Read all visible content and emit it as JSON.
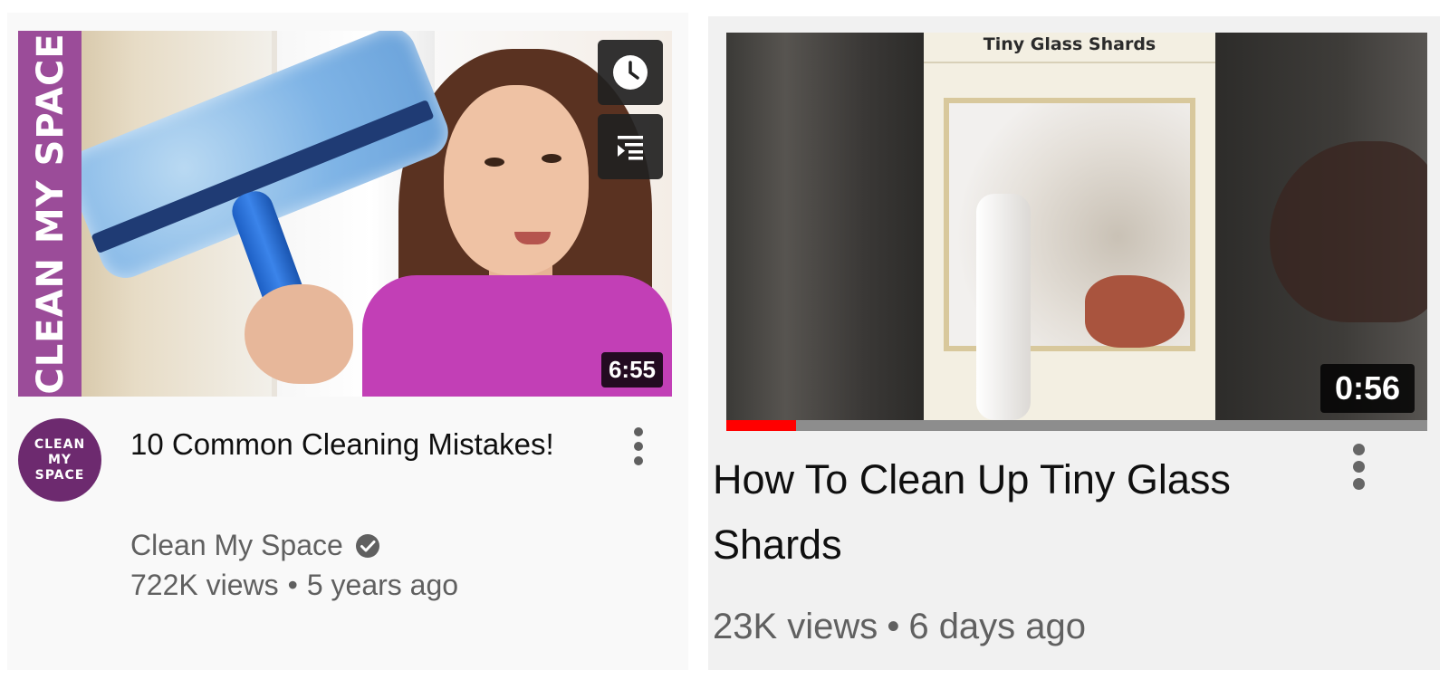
{
  "cards": [
    {
      "thumbnail": {
        "band_text": "CLEAN MY SPACE",
        "duration": "6:55",
        "hover_buttons": [
          "watch-later-icon",
          "add-to-queue-icon"
        ]
      },
      "avatar": {
        "lines": [
          "CLEAN",
          "MY",
          "SPACE"
        ],
        "color": "#6d2a6f"
      },
      "title": "10 Common Cleaning Mistakes!",
      "channel": "Clean My Space",
      "verified": true,
      "views": "722K views",
      "separator": "•",
      "age": "5 years ago",
      "menu_icon": "kebab-menu-icon"
    },
    {
      "thumbnail": {
        "banner_text": "Tiny Glass Shards",
        "duration": "0:56",
        "progress_fraction": 0.1
      },
      "title": "How To Clean Up Tiny Glass Shards",
      "views": "23K views",
      "separator": "•",
      "age": "6 days ago",
      "menu_icon": "kebab-menu-icon"
    }
  ],
  "colors": {
    "progress": "#ff0000",
    "band": "#9b4c99",
    "meta_text": "#606060"
  }
}
